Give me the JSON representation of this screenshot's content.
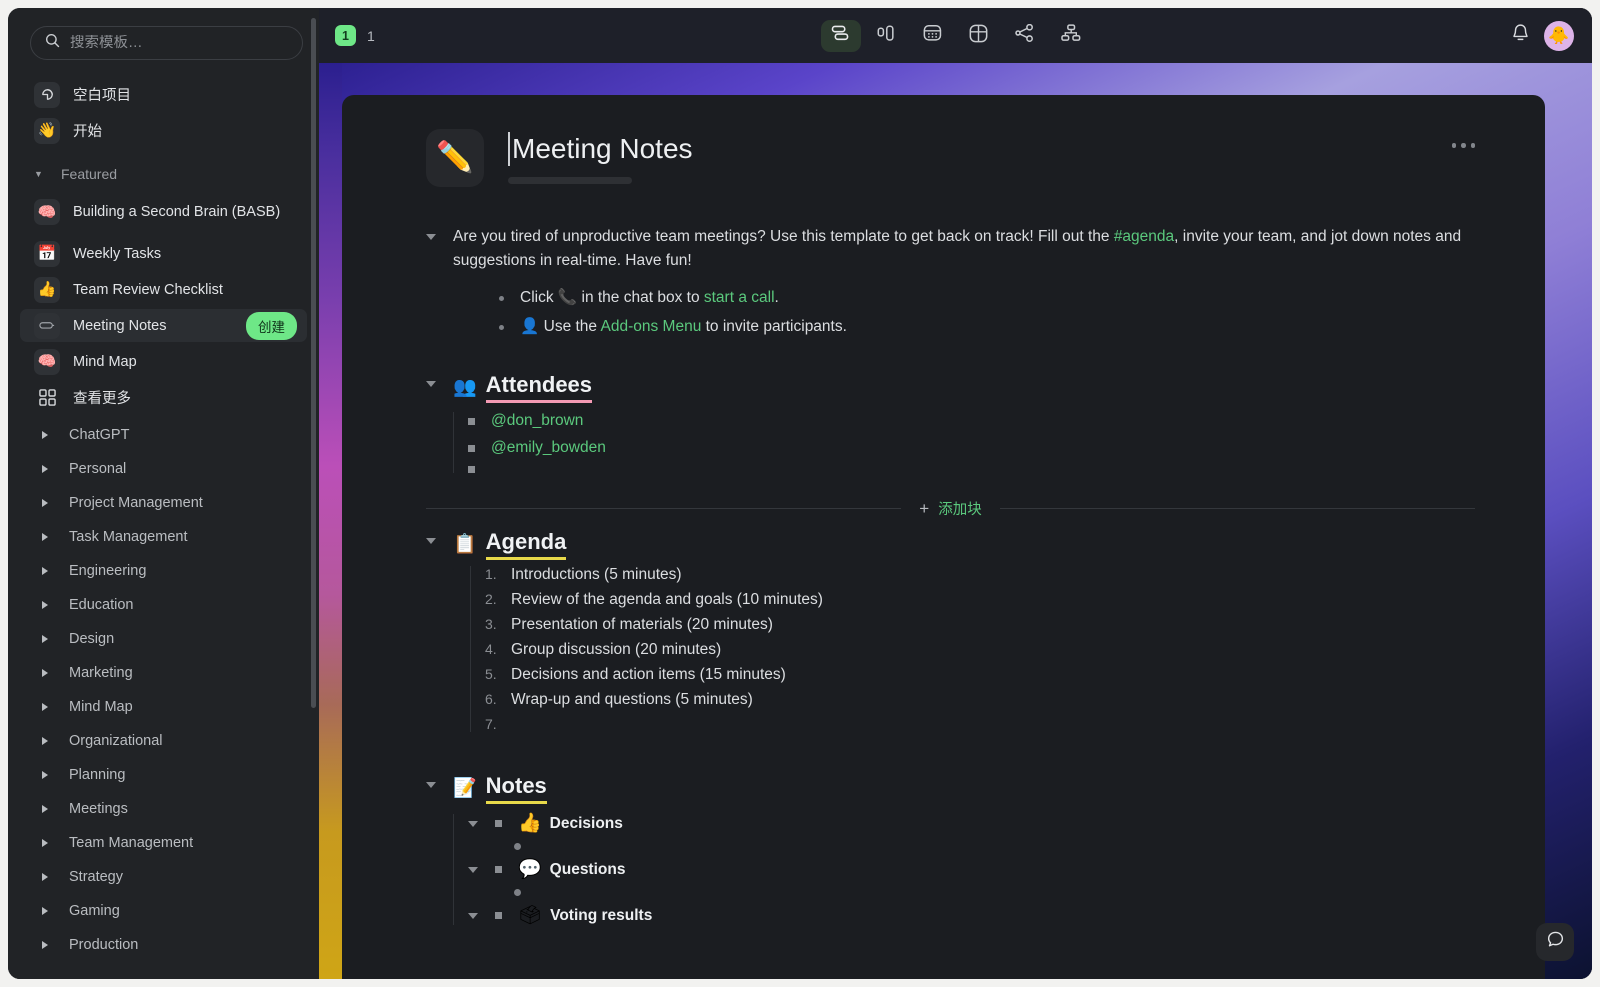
{
  "sidebar": {
    "search": {
      "placeholder": "搜索模板…",
      "value": "",
      "icon": "search-icon"
    },
    "quick": [
      {
        "label": "空白项目",
        "icon": "blank-page-icon"
      },
      {
        "label": "开始",
        "icon": "wave-hand-emoji"
      }
    ],
    "featured_section": {
      "label": "Featured",
      "caret": "▼"
    },
    "featured": [
      {
        "label": "Building a Second Brain (BASB)",
        "icon": "🧠",
        "action": ""
      },
      {
        "label": "Weekly Tasks",
        "icon": "📅",
        "action": ""
      },
      {
        "label": "Team Review Checklist",
        "icon": "👍",
        "action": ""
      },
      {
        "label": "Meeting Notes",
        "icon": "✏",
        "action": "创建",
        "selected": true
      },
      {
        "label": "Mind Map",
        "icon": "🧠",
        "action": ""
      }
    ],
    "see_more": {
      "label": "查看更多",
      "icon": "grid-icon"
    },
    "categories": [
      {
        "label": "ChatGPT"
      },
      {
        "label": "Personal"
      },
      {
        "label": "Project Management"
      },
      {
        "label": "Task Management"
      },
      {
        "label": "Engineering"
      },
      {
        "label": "Education"
      },
      {
        "label": "Design"
      },
      {
        "label": "Marketing"
      },
      {
        "label": "Mind Map"
      },
      {
        "label": "Organizational"
      },
      {
        "label": "Planning"
      },
      {
        "label": "Meetings"
      },
      {
        "label": "Team Management"
      },
      {
        "label": "Strategy"
      },
      {
        "label": "Gaming"
      },
      {
        "label": "Production"
      }
    ]
  },
  "topbar": {
    "badge": "1",
    "crumb": "1",
    "tools": [
      {
        "name": "board-view-icon",
        "active": true
      },
      {
        "name": "split-view-icon",
        "active": false
      },
      {
        "name": "calendar-view-icon",
        "active": false
      },
      {
        "name": "table-view-icon",
        "active": false
      },
      {
        "name": "share-graph-icon",
        "active": false
      },
      {
        "name": "org-chart-icon",
        "active": false
      }
    ],
    "bell": "notification-bell-icon",
    "avatar": "🐥"
  },
  "document": {
    "emoji": "✏️",
    "title": "Meeting Notes",
    "more_menu": "…",
    "intro": {
      "before_link": "Are you tired of unproductive team meetings? Use this template to get back on track! Fill out the ",
      "link": "#agenda",
      "after_link": ", invite your team, and jot down notes and suggestions in real-time. Have fun!"
    },
    "intro_bullets": [
      {
        "pre": "Click ",
        "emoji": "📞",
        "mid": " in the chat box to ",
        "link": "start a call",
        "post": "."
      },
      {
        "pre": "",
        "emoji": "👤",
        "mid": " Use the ",
        "link": "Add-ons Menu",
        "post": " to invite participants."
      }
    ],
    "attendees": {
      "emoji": "👥",
      "title": "Attendees",
      "items": [
        "@don_brown",
        "@emily_bowden",
        ""
      ]
    },
    "add_block": {
      "plus": "+",
      "label": "添加块"
    },
    "agenda": {
      "emoji": "📋",
      "title": "Agenda",
      "items": [
        "Introductions (5 minutes)",
        "Review of the agenda and goals (10 minutes)",
        "Presentation of materials (20 minutes)",
        "Group discussion (20 minutes)",
        "Decisions and action items (15 minutes)",
        "Wrap-up and questions (5 minutes)",
        ""
      ]
    },
    "notes": {
      "emoji": "📝",
      "title": "Notes",
      "subsections": [
        {
          "emoji": "👍",
          "title": "Decisions"
        },
        {
          "emoji": "💬",
          "title": "Questions"
        },
        {
          "emoji": "🗳",
          "title": "Voting results"
        }
      ]
    }
  },
  "chat_fab": "chat-bubble-icon"
}
